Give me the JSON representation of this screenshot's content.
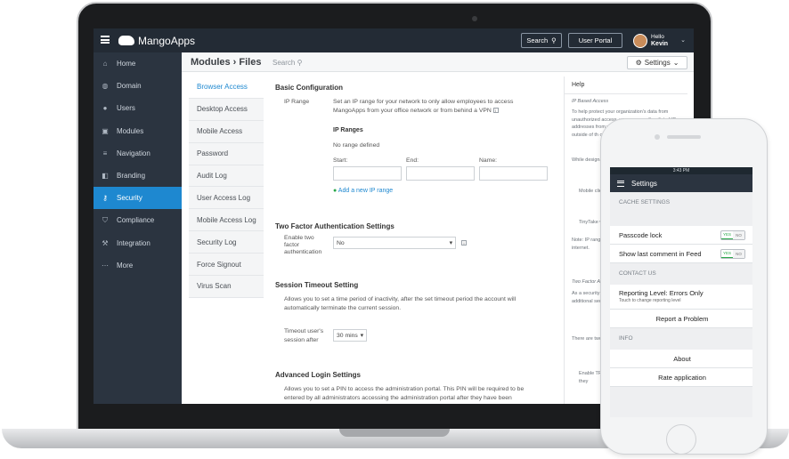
{
  "app": {
    "brand": "MangoApps",
    "search_button": "Search",
    "user_portal_button": "User Portal",
    "user_greeting": "Hello",
    "user_name": "Kevin"
  },
  "sidebar": {
    "items": [
      {
        "label": "Home",
        "icon": "home-icon",
        "glyph": "⌂"
      },
      {
        "label": "Domain",
        "icon": "globe-icon",
        "glyph": "◍"
      },
      {
        "label": "Users",
        "icon": "user-icon",
        "glyph": "●"
      },
      {
        "label": "Modules",
        "icon": "modules-icon",
        "glyph": "▣"
      },
      {
        "label": "Navigation",
        "icon": "list-icon",
        "glyph": "≡"
      },
      {
        "label": "Branding",
        "icon": "branding-icon",
        "glyph": "◧"
      },
      {
        "label": "Security",
        "icon": "key-icon",
        "glyph": "⚷",
        "active": true
      },
      {
        "label": "Compliance",
        "icon": "shield-icon",
        "glyph": "⛉"
      },
      {
        "label": "Integration",
        "icon": "wrench-icon",
        "glyph": "⚒"
      },
      {
        "label": "More",
        "icon": "more-icon",
        "glyph": "⋯"
      }
    ]
  },
  "header": {
    "title": "Modules › Files",
    "search_placeholder": "Search",
    "settings_label": "Settings"
  },
  "subnav": {
    "items": [
      "Browser Access",
      "Desktop Access",
      "Mobile Access",
      "Password",
      "Audit Log",
      "User Access Log",
      "Mobile Access Log",
      "Security Log",
      "Force Signout",
      "Virus Scan"
    ]
  },
  "main": {
    "basic_heading": "Basic Configuration",
    "ip_label": "IP Range",
    "ip_desc": "Set an IP range for your network to only allow employees to access MangoApps from your office network or from behind a VPN",
    "ip_ranges_heading": "IP Ranges",
    "no_range": "No range defined",
    "start_label": "Start:",
    "end_label": "End:",
    "name_label": "Name:",
    "add_ip": "Add a new IP range",
    "tfa_heading": "Two Factor Authentication Settings",
    "tfa_label": "Enable two factor authentication",
    "tfa_value": "No",
    "timeout_heading": "Session Timeout Setting",
    "timeout_desc": "Allows you to set a time period of inactivity, after the set timeout period the account will automatically terminate the current session.",
    "timeout_label": "Timeout user's session after",
    "timeout_value": "30 mins",
    "adv_heading": "Advanced Login Settings",
    "adv_desc": "Allows you to set a PIN to access the administration portal. This PIN will be required to be entered by all administrators accessing the administration portal after they have been"
  },
  "help": {
    "title": "Help",
    "p1": "IP Based Access",
    "p2": "To help protect your organization's data from unauthorized access, you can specify a list of IP addresses from which users can log in. Users outside of th cannot access th",
    "p3": "While designat web, there are approach, inclu",
    "p4": "Mobile clien and Androi the networ",
    "p5": "TinyTake w the IP rang",
    "p6": "Note: IP range 192.168.255.2 are private IP r the internet.",
    "p7": "Two Factor Aut",
    "p8": "As a security m Factor Authenti organization. W additional secu accounts.",
    "p9": "There are two authentication-c can either.",
    "p10": "Enable TFA Ensure eac email ID se where they"
  },
  "phone": {
    "time": "3:43 PM",
    "title": "Settings",
    "cache_section": "CACHE SETTINGS",
    "passcode_label": "Passcode lock",
    "show_comment_label": "Show last comment in Feed",
    "toggle_on": "YES",
    "toggle_off": "NO",
    "contact_section": "CONTACT US",
    "reporting_label": "Reporting Level: Errors Only",
    "reporting_hint": "Touch to change reporting level",
    "report_problem": "Report a Problem",
    "info_section": "INFO",
    "about": "About",
    "rate": "Rate application"
  }
}
